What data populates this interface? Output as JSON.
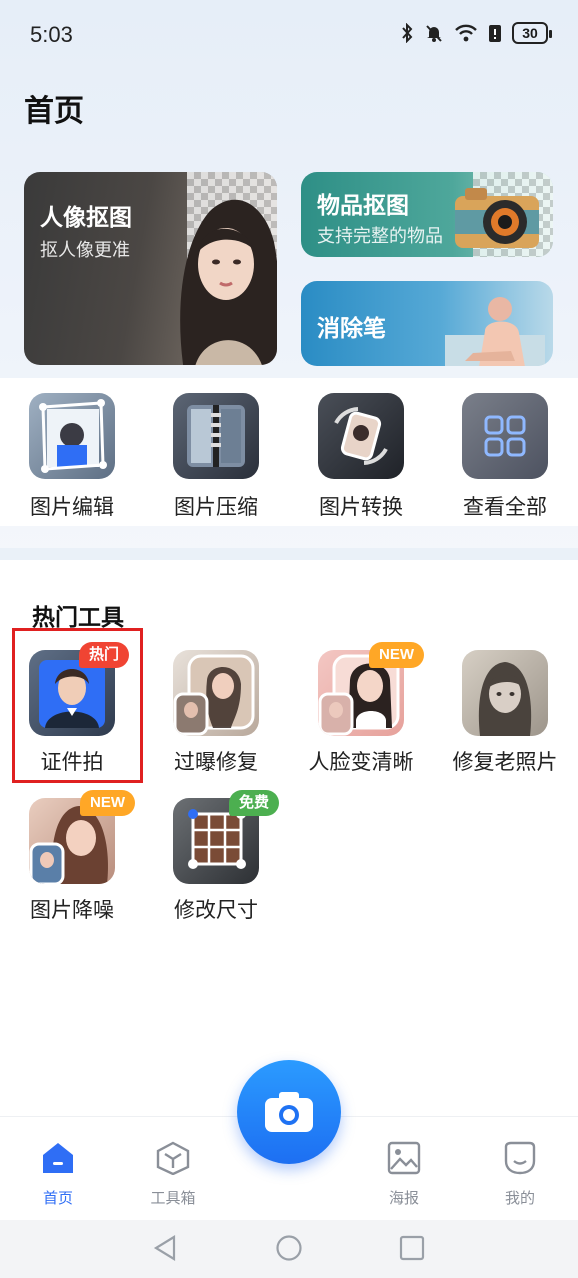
{
  "status_bar": {
    "time": "5:03",
    "battery": "30"
  },
  "page": {
    "title": "首页"
  },
  "feature_cards": {
    "portrait": {
      "title": "人像抠图",
      "subtitle": "抠人像更准"
    },
    "object": {
      "title": "物品抠图",
      "subtitle": "支持完整的物品"
    },
    "eraser": {
      "title": "消除笔"
    }
  },
  "quick_tools": [
    {
      "label": "图片编辑"
    },
    {
      "label": "图片压缩"
    },
    {
      "label": "图片转换"
    },
    {
      "label": "查看全部"
    }
  ],
  "hot_tools": {
    "title": "热门工具",
    "items": [
      {
        "label": "证件拍",
        "badge": "热门"
      },
      {
        "label": "过曝修复"
      },
      {
        "label": "人脸变清晰",
        "badge": "NEW"
      },
      {
        "label": "修复老照片"
      },
      {
        "label": "图片降噪",
        "badge": "NEW"
      },
      {
        "label": "修改尺寸",
        "badge": "免费"
      }
    ]
  },
  "bottom_nav": [
    {
      "label": "首页",
      "icon": "home-icon",
      "active": true
    },
    {
      "label": "工具箱",
      "icon": "toolbox-icon"
    },
    {
      "label": "海报",
      "icon": "poster-icon"
    },
    {
      "label": "我的",
      "icon": "profile-icon"
    }
  ],
  "colors": {
    "accent": "#2f6ef5",
    "hot_badge": "#f04433",
    "new_badge": "#ffa726",
    "free_badge": "#4caf50"
  }
}
